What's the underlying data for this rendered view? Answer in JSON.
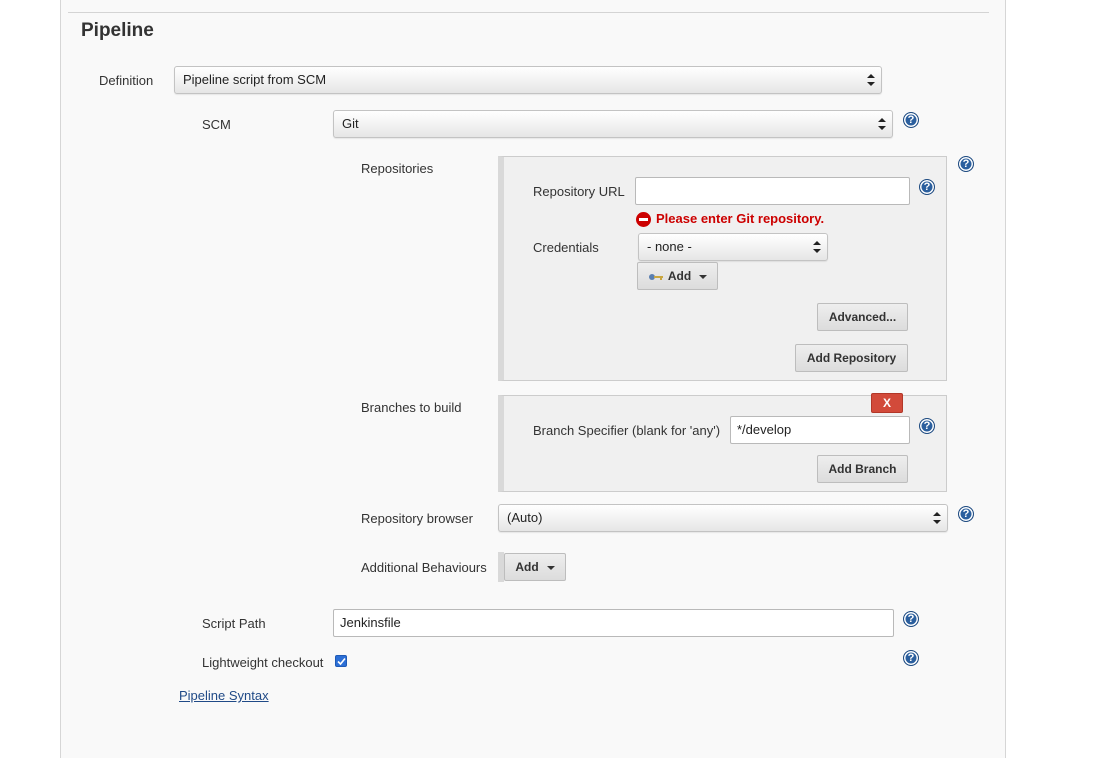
{
  "section": {
    "title": "Pipeline"
  },
  "definition": {
    "label": "Definition",
    "value": "Pipeline script from SCM"
  },
  "scm": {
    "label": "SCM",
    "value": "Git"
  },
  "repositories": {
    "label": "Repositories",
    "url_label": "Repository URL",
    "url_value": "",
    "error_text": "Please enter Git repository.",
    "credentials_label": "Credentials",
    "credentials_value": "- none -",
    "add_label": "Add",
    "advanced_label": "Advanced...",
    "add_repository_label": "Add Repository"
  },
  "branches": {
    "label": "Branches to build",
    "delete_label": "X",
    "specifier_label": "Branch Specifier (blank for 'any')",
    "specifier_value": "*/develop",
    "add_branch_label": "Add Branch"
  },
  "repo_browser": {
    "label": "Repository browser",
    "value": "(Auto)"
  },
  "behaviours": {
    "label": "Additional Behaviours",
    "add_label": "Add"
  },
  "script_path": {
    "label": "Script Path",
    "value": "Jenkinsfile"
  },
  "lightweight": {
    "label": "Lightweight checkout",
    "checked": true
  },
  "syntax_link": "Pipeline Syntax",
  "help_glyph": "?",
  "colors": {
    "error": "#cc0000",
    "help": "#2b5f9e",
    "delete": "#d24a3a",
    "link": "#204a87"
  }
}
